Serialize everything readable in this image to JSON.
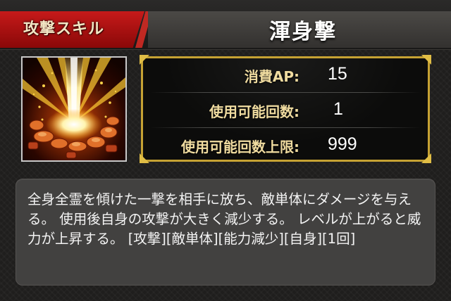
{
  "header": {
    "category_label": "攻撃スキル",
    "skill_name": "渾身撃"
  },
  "icon": {
    "name": "fire-burst-icon",
    "colors": {
      "core": "#fff6c8",
      "glow": "#ffb400",
      "ember": "#c84a10",
      "background": "#120300"
    }
  },
  "stats": [
    {
      "label": "消費AP:",
      "value": "15"
    },
    {
      "label": "使用可能回数:",
      "value": "1"
    },
    {
      "label": "使用可能回数上限:",
      "value": "999"
    }
  ],
  "description": "全身全霊を傾けた一撃を相手に放ち、敵単体にダメージを与える。 使用後自身の攻撃が大きく減少する。 レベルが上がると威力が上昇する。 [攻撃][敵単体][能力減少][自身][1回]",
  "colors": {
    "accent_red": "#c61a1a",
    "gold_frame": "#c6a233",
    "label_gold": "#f0dca0"
  }
}
